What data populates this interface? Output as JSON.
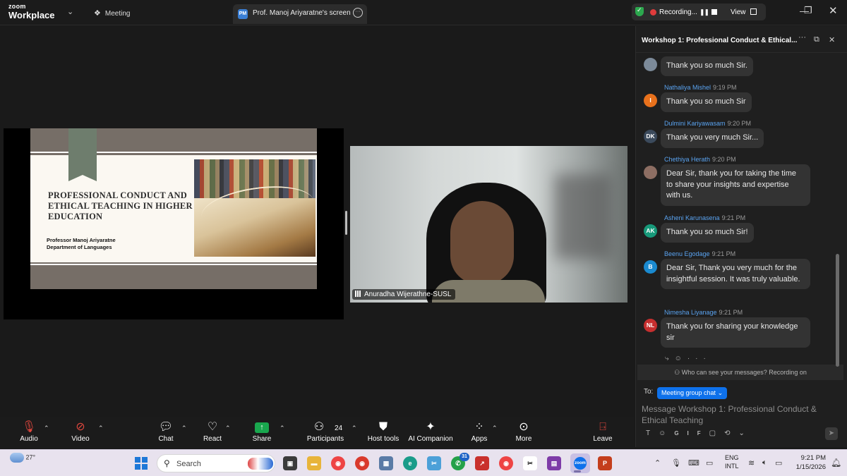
{
  "titlebar": {
    "brand_top": "zoom",
    "brand_bottom": "Workplace",
    "meeting_label": "Meeting",
    "tab_initials": "PM",
    "tab_title": "Prof. Manoj Ariyaratne's screen",
    "recording_label": "Recording...",
    "view_label": "View",
    "colors": {
      "recording": "#e03c3c",
      "shield": "#2ca84e"
    }
  },
  "slide": {
    "title": "PROFESSIONAL CONDUCT AND ETHICAL TEACHING IN HIGHER EDUCATION",
    "author": "Professor Manoj Ariyaratne",
    "department": "Department of Languages"
  },
  "camera": {
    "participant_name": "Anuradha Wijerathne-SUSL"
  },
  "chat": {
    "title": "Workshop 1: Professional Conduct & Ethical...",
    "messages": [
      {
        "initials": "",
        "avatar_color": "#7c8a99",
        "name": "",
        "time": "",
        "text": "Thank you so much Sir."
      },
      {
        "initials": "I",
        "avatar_color": "#e8711c",
        "name": "Nathaliya Mishel",
        "time": "9:19 PM",
        "text": "Thank you so much Sir"
      },
      {
        "initials": "DK",
        "avatar_color": "#3b4a5c",
        "name": "Dulmini Kariyawasam",
        "time": "9:20 PM",
        "text": "Thank you very much Sir..."
      },
      {
        "initials": "",
        "avatar_color": "#8d6e63",
        "name": "Chethiya Herath",
        "time": "9:20 PM",
        "text": "Dear Sir, thank you for taking the time to share your insights and expertise with us."
      },
      {
        "initials": "AK",
        "avatar_color": "#17997a",
        "name": "Asheni Karunasena",
        "time": "9:21 PM",
        "text": "Thank you so much Sir!"
      },
      {
        "initials": "B",
        "avatar_color": "#1a8ad0",
        "name": "Beenu Egodage",
        "time": "9:21 PM",
        "text": "Dear Sir, Thank you very much for the insightful session. It was truly valuable."
      },
      {
        "initials": "NL",
        "avatar_color": "#c62f2f",
        "name": "Nimesha Liyanage",
        "time": "9:21 PM",
        "text": "Thank you for sharing your knowledge sir"
      }
    ],
    "notice": "Who can see your messages? Recording on",
    "to_label": "To:",
    "to_value": "Meeting group chat",
    "compose_placeholder": "Message Workshop 1: Professional Conduct & Ethical Teaching",
    "format_label": "GIF"
  },
  "toolbar": {
    "audio": "Audio",
    "video": "Video",
    "chat": "Chat",
    "react": "React",
    "share": "Share",
    "participants": "Participants",
    "participants_count": "24",
    "host_tools": "Host tools",
    "ai_companion": "AI Companion",
    "apps": "Apps",
    "more": "More",
    "leave": "Leave"
  },
  "taskbar": {
    "temperature": "27°",
    "search_label": "Search",
    "badge_count": "31",
    "lang_top": "ENG",
    "lang_bottom": "INTL",
    "time": "9:21 PM",
    "date": "1/15/2026"
  }
}
